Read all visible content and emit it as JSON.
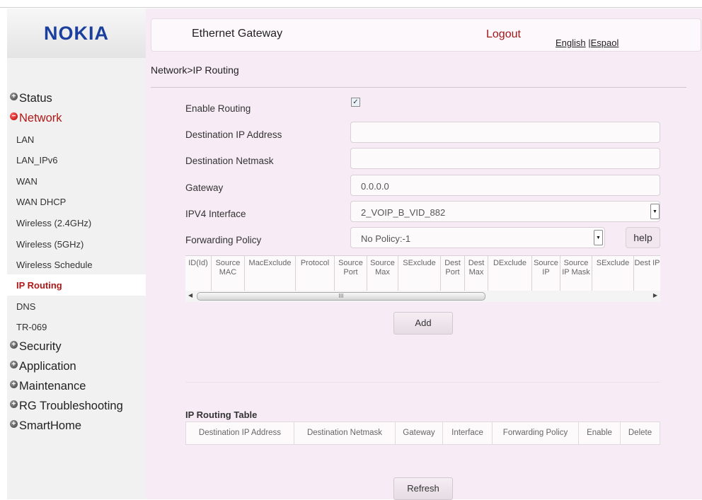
{
  "brand": {
    "logo_text": "NOKIA",
    "logo_color": "#1a3f9c"
  },
  "header": {
    "title": "Ethernet Gateway",
    "logout": "Logout",
    "lang_english": "English",
    "lang_sep": " |",
    "lang_espanol": "Espaol"
  },
  "breadcrumb": "Network>IP Routing",
  "sidebar": {
    "groups": [
      {
        "label": "Status",
        "icon": "plus-icon"
      },
      {
        "label": "Network",
        "icon": "minus-icon",
        "active": true
      },
      {
        "label": "Security",
        "icon": "plus-icon"
      },
      {
        "label": "Application",
        "icon": "plus-icon"
      },
      {
        "label": "Maintenance",
        "icon": "plus-icon"
      },
      {
        "label": "RG Troubleshooting",
        "icon": "plus-icon"
      },
      {
        "label": "SmartHome",
        "icon": "plus-icon"
      }
    ],
    "network_items": [
      "LAN",
      "LAN_IPv6",
      "WAN",
      "WAN DHCP",
      "Wireless (2.4GHz)",
      "Wireless (5GHz)",
      "Wireless Schedule",
      "IP Routing",
      "DNS",
      "TR-069"
    ],
    "active_item": "IP Routing"
  },
  "form": {
    "enable_routing_label": "Enable Routing",
    "enable_routing_checked": true,
    "dest_ip_label": "Destination IP Address",
    "dest_ip_value": "",
    "dest_netmask_label": "Destination Netmask",
    "dest_netmask_value": "",
    "gateway_label": "Gateway",
    "gateway_value": "0.0.0.0",
    "ipv4_interface_label": "IPV4 Interface",
    "ipv4_interface_value": "2_VOIP_B_VID_882",
    "forwarding_policy_label": "Forwarding Policy",
    "forwarding_policy_value": "No Policy:-1",
    "help_label": "help"
  },
  "policy_grid": {
    "columns": [
      "ID(Id)",
      "Source MAC",
      "MacExclude",
      "Protocol",
      "Source Port",
      "Source Max",
      "SExclude",
      "Dest Port",
      "Dest Max",
      "DExclude",
      "Source IP",
      "Source IP Mask",
      "SExclude",
      "Dest IP"
    ],
    "scroll_thumb": "III"
  },
  "add_label": "Add",
  "routing_table": {
    "title": "IP Routing Table",
    "columns": [
      "Destination IP Address",
      "Destination Netmask",
      "Gateway",
      "Interface",
      "Forwarding Policy",
      "Enable",
      "Delete"
    ]
  },
  "refresh_label": "Refresh",
  "colors": {
    "accent_red": "#b01818",
    "panel_bg": "#f7ecf5"
  }
}
